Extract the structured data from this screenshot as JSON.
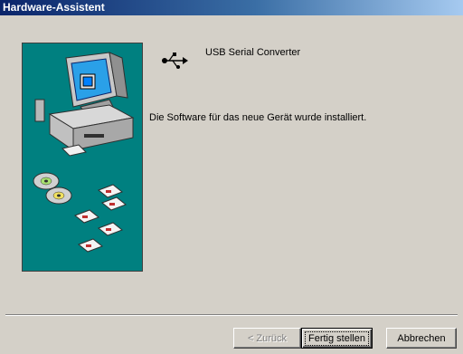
{
  "window": {
    "title": "Hardware-Assistent"
  },
  "device": {
    "icon": "usb-icon",
    "name": "USB Serial Converter"
  },
  "message": "Die Software für das neue Gerät wurde installiert.",
  "buttons": {
    "back": "< Zurück",
    "finish": "Fertig stellen",
    "cancel": "Abbrechen"
  },
  "colors": {
    "titlebar_start": "#0a246a",
    "titlebar_end": "#a6caf0",
    "face": "#d4d0c8",
    "illustration_bg": "#008080"
  }
}
